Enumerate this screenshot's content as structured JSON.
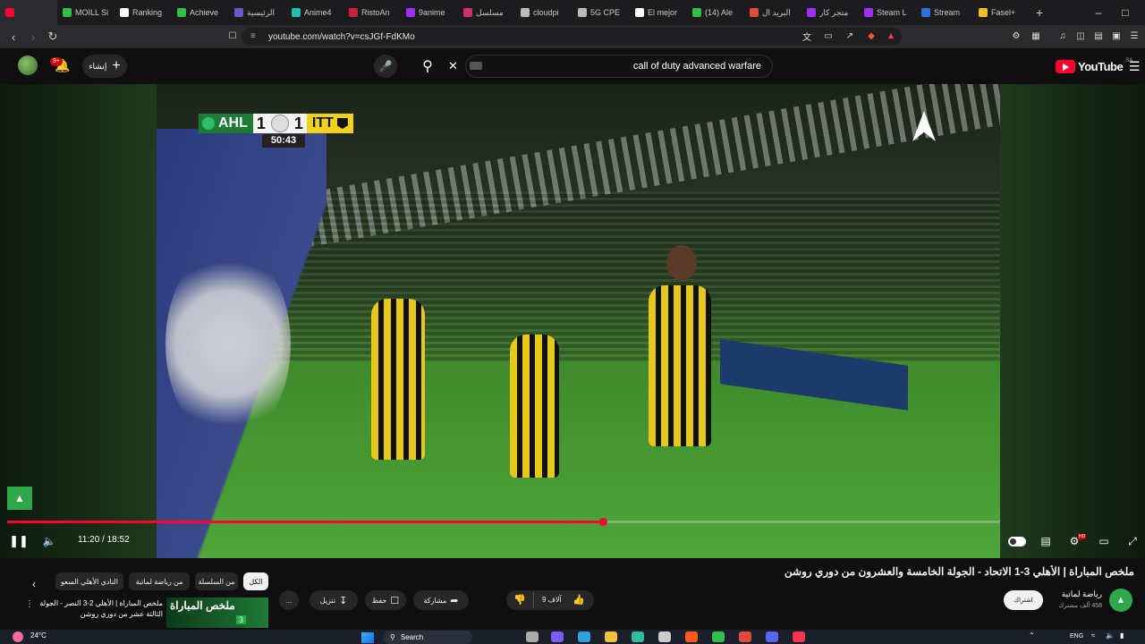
{
  "browser": {
    "tabs": [
      {
        "label": "",
        "color": "#ff0033",
        "active": true
      },
      {
        "label": "MOILL Si",
        "color": "#2fbf4a"
      },
      {
        "label": "Ranking",
        "color": "#ffffff"
      },
      {
        "label": "Achieve",
        "color": "#2fbf4a"
      },
      {
        "label": "الرئيسية",
        "color": "#6a5acd"
      },
      {
        "label": "Anime4",
        "color": "#20c0b0"
      },
      {
        "label": "RistoAn",
        "color": "#d02040"
      },
      {
        "label": "9anime",
        "color": "#9b30ff"
      },
      {
        "label": "مسلسل",
        "color": "#d0306a"
      },
      {
        "label": "cloudpi",
        "color": "#bbbbbb"
      },
      {
        "label": "5G CPE",
        "color": "#bbbbbb"
      },
      {
        "label": "El mejor",
        "color": "#ffffff"
      },
      {
        "label": "(14) Ale",
        "color": "#2fbf4a"
      },
      {
        "label": "البريد ال",
        "color": "#e04a3c"
      },
      {
        "label": "متجر كار",
        "color": "#9b30ff"
      },
      {
        "label": "Steam L",
        "color": "#9b30ff"
      },
      {
        "label": "Stream",
        "color": "#2f6fdf"
      },
      {
        "label": "Fasel+",
        "color": "#f0c020"
      }
    ],
    "new_tab": "+",
    "url": "youtube.com/watch?v=csJGf-FdKMo"
  },
  "youtube": {
    "logo": "YouTube",
    "region": "SA",
    "create_label": "إنشاء",
    "notifications_count": "9+",
    "search_query": "call of duty advanced warfare"
  },
  "video": {
    "scorebug": {
      "home": "AHL",
      "home_score": "1",
      "away_score": "1",
      "away": "ITT",
      "clock": "50:43"
    },
    "time_current": "11:20",
    "time_total": "18:52",
    "time_display": "11:20 / 18:52",
    "progress_fraction": 0.6,
    "settings_badge": "HD"
  },
  "below": {
    "title": "ملخص المباراة | الأهلي 3-1 الاتحاد - الجولة الخامسة والعشرون من دوري روشن",
    "channel_name": "رياضة لماتية",
    "subscribers": "458 ألف مشترك",
    "subscribe_label": "اشتراك",
    "like_count": "9 آلاف",
    "share_label": "مشاركة",
    "save_label": "حفظ",
    "download_label": "تنزيل",
    "more_label": "...",
    "chips": [
      "الكل",
      "من السلسلة",
      "من رياضة لماتية",
      "النادي الأهلي السعو"
    ],
    "next_video_title": "ملخص المباراة | الأهلي 2-3 النصر - الجولة الثالثة عشر من دوري روشن",
    "next_video_thumb_text": "ملخص المباراة",
    "next_video_thumb_score": "3"
  },
  "taskbar": {
    "weather": "24°C",
    "search_label": "Search",
    "language": "ENG"
  }
}
